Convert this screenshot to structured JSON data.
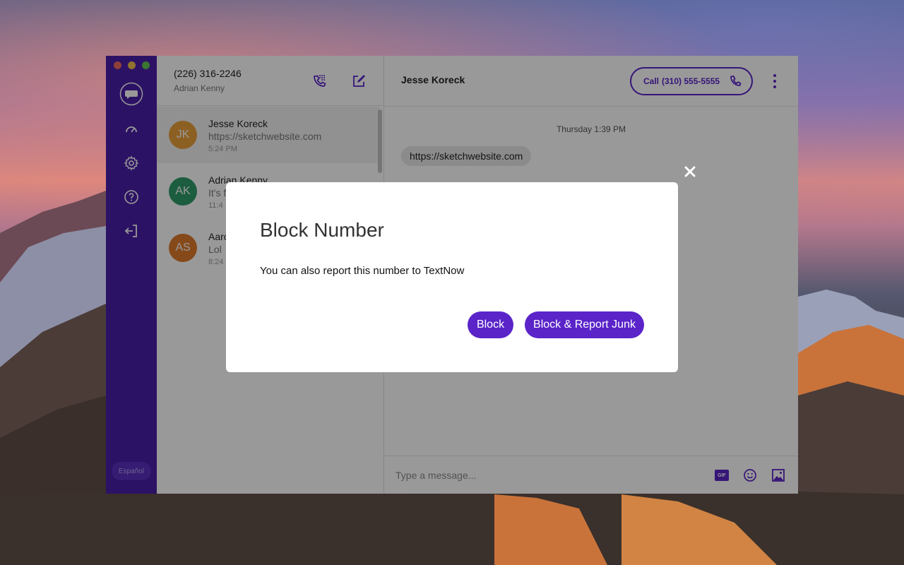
{
  "colors": {
    "accent": "#5a24c9",
    "rail": "#4a1fa8"
  },
  "user": {
    "phone": "(226) 316-2246",
    "name": "Adrian Kenny"
  },
  "rail": {
    "language_label": "Español"
  },
  "conversations": [
    {
      "initials": "JK",
      "name": "Jesse Koreck",
      "preview": "https://sketchwebsite.com",
      "time": "5:24 PM",
      "color": "#e9a13b"
    },
    {
      "initials": "AK",
      "name": "Adrian Kenny",
      "preview": "It's f",
      "time": "11:4",
      "color": "#2f9c6a"
    },
    {
      "initials": "AS",
      "name": "Aaro",
      "preview": "Lol",
      "time": "8:24",
      "color": "#e07a2a"
    }
  ],
  "chat": {
    "contact": "Jesse Koreck",
    "call_prefix": "Call",
    "call_number": "(310) 555-5555",
    "date": "Thursday 1:39 PM",
    "message": "https://sketchwebsite.com",
    "input_placeholder": "Type a message...",
    "gif_label": "GIF"
  },
  "dialog": {
    "title": "Block Number",
    "body": "You can also report this number to TextNow",
    "block_label": "Block",
    "block_report_label": "Block & Report Junk"
  }
}
